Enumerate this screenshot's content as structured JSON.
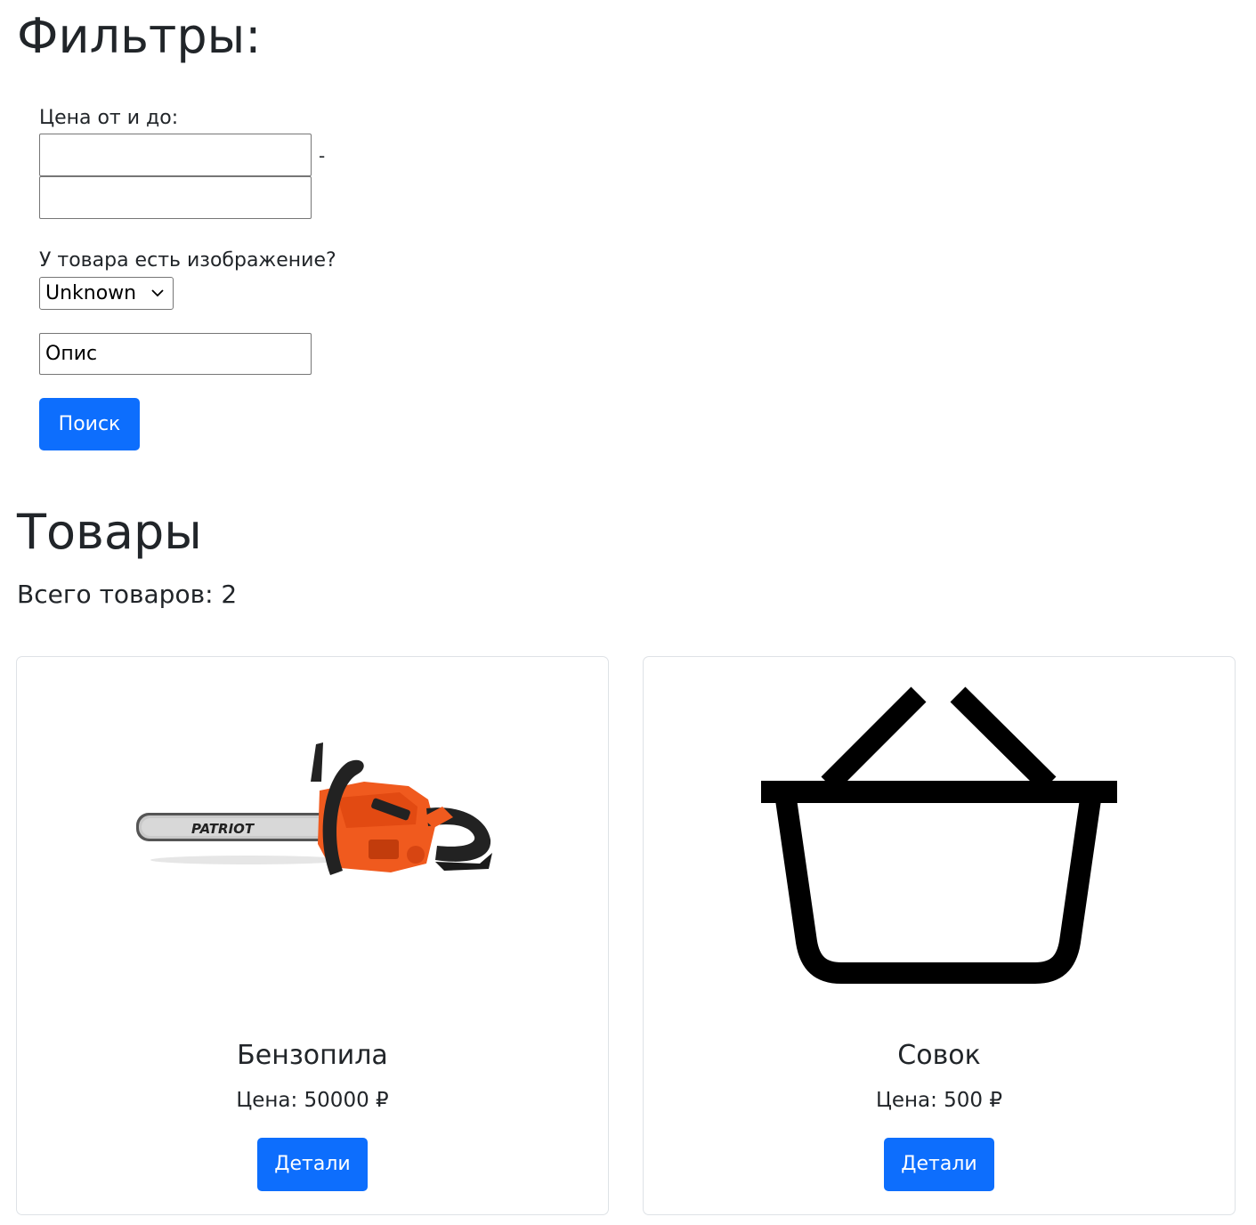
{
  "filters": {
    "title": "Фильтры:",
    "price_label": "Цена от и до:",
    "price_from_value": "",
    "price_to_value": "",
    "price_separator": "-",
    "has_image_label": "У товара есть изображение?",
    "has_image_selected": "Unknown",
    "description_value": "Опис",
    "search_button": "Поиск"
  },
  "products": {
    "title": "Товары",
    "total_label": "Всего товаров: 2",
    "items": [
      {
        "name": "Бензопила",
        "price": "Цена: 50000 ₽",
        "details_button": "Детали",
        "image": "chainsaw-image"
      },
      {
        "name": "Совок",
        "price": "Цена: 500 ₽",
        "details_button": "Детали",
        "image": "basket-icon"
      }
    ]
  },
  "colors": {
    "primary": "#0d6efd",
    "text": "#212529",
    "card_border": "#dee2e6",
    "chainsaw_orange": "#f05a1e"
  }
}
